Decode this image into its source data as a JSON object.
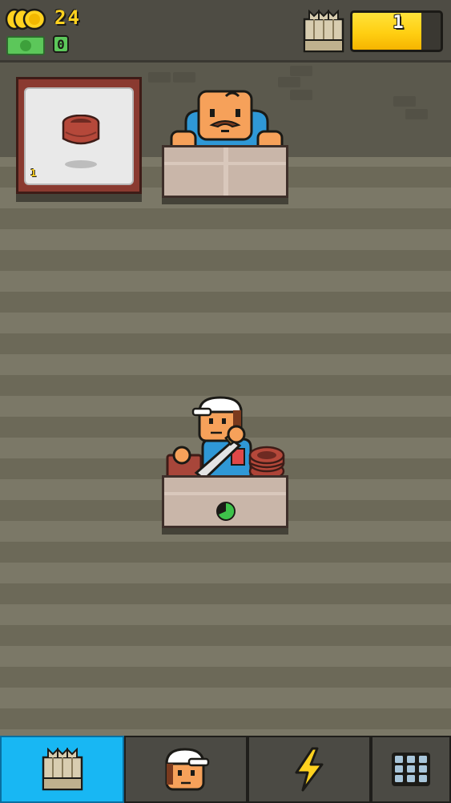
{
  "hud": {
    "coins": "24",
    "cash": "0",
    "level": "1",
    "level_progress": 0.78,
    "coin_icon": "coin-stack-icon",
    "cash_icon": "banknote-icon",
    "crate_icon": "crate-icon"
  },
  "display": {
    "product": "clay-pot",
    "count": "1"
  },
  "nav": {
    "tabs": [
      {
        "name": "crates",
        "icon": "crate-icon",
        "active": true
      },
      {
        "name": "workers",
        "icon": "worker-icon",
        "active": false
      },
      {
        "name": "boosts",
        "icon": "lightning-icon",
        "active": false
      },
      {
        "name": "menu",
        "icon": "grid-icon",
        "active": false
      }
    ]
  },
  "colors": {
    "accent": "#18b7f3",
    "coin": "#ffd21f",
    "cash": "#5cc75a",
    "progress": "#ffcf12"
  }
}
